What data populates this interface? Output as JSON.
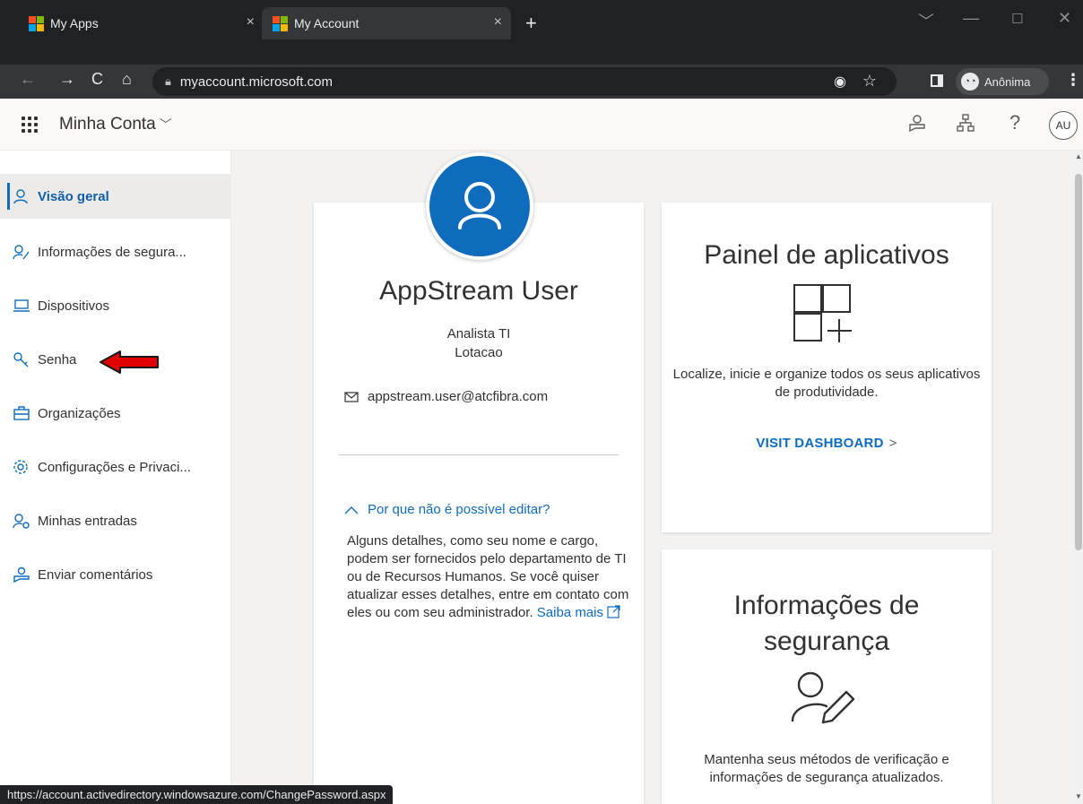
{
  "browser": {
    "tabs": [
      {
        "title": "My Apps",
        "close": "×"
      },
      {
        "title": "My Account",
        "close": "×"
      }
    ],
    "new_tab": "+",
    "url": "myaccount.microsoft.com",
    "profile_label": "Anônima"
  },
  "app": {
    "title": "Minha Conta",
    "avatar_initials": "AU"
  },
  "sidebar": {
    "items": [
      {
        "label": "Visão geral",
        "icon": "person-icon"
      },
      {
        "label": "Informações de segura...",
        "icon": "person-key-icon"
      },
      {
        "label": "Dispositivos",
        "icon": "laptop-icon"
      },
      {
        "label": "Senha",
        "icon": "key-icon"
      },
      {
        "label": "Organizações",
        "icon": "briefcase-icon"
      },
      {
        "label": "Configurações e Privaci...",
        "icon": "gear-icon"
      },
      {
        "label": "Minhas entradas",
        "icon": "person-key-icon"
      },
      {
        "label": "Enviar comentários",
        "icon": "feedback-icon"
      }
    ]
  },
  "profile": {
    "name": "AppStream User",
    "job_title": "Analista TI",
    "location": "Lotacao",
    "email": "appstream.user@atcfibra.com",
    "why_link": "Por que não é possível editar?",
    "why_text": "Alguns detalhes, como seu nome e cargo, podem ser fornecidos pelo departamento de TI ou de Recursos Humanos. Se você quiser atualizar esses detalhes, entre em contato com eles ou com seu administrador.",
    "learn_more": "Saiba mais"
  },
  "dashboard_card": {
    "title": "Painel de aplicativos",
    "description": "Localize, inicie e organize todos os seus aplicativos de produtividade.",
    "link": "VISIT DASHBOARD",
    "link_chevron": ">"
  },
  "security_card": {
    "title_line1": "Informações de",
    "title_line2": "segurança",
    "description": "Mantenha seus métodos de verificação e informações de segurança atualizados."
  },
  "status_bar": {
    "url": "https://account.activedirectory.windowsazure.com/ChangePassword.aspx"
  },
  "colors": {
    "accent": "#0f6cbd",
    "chrome_dark": "#202124",
    "annotation_arrow": "#e00000"
  }
}
